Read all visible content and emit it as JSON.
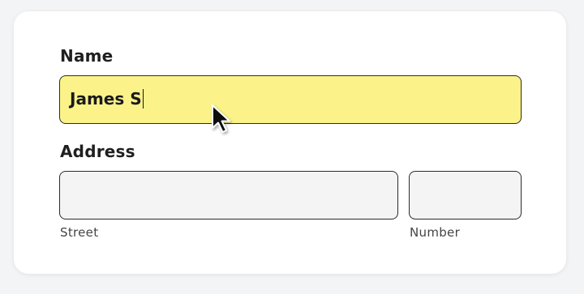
{
  "form": {
    "name_label": "Name",
    "name_value": "James S",
    "address_label": "Address",
    "street_value": "",
    "street_label": "Street",
    "number_value": "",
    "number_label": "Number"
  },
  "colors": {
    "active_field": "#fbf38a",
    "field_background": "#f4f4f4"
  },
  "icons": {
    "pointer": "mouse-pointer-icon"
  }
}
